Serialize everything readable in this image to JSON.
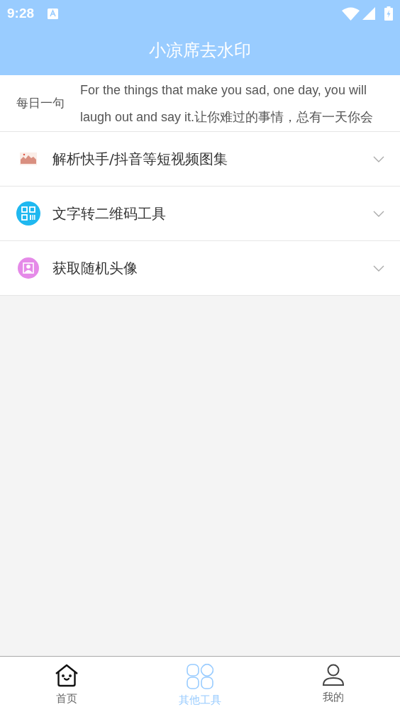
{
  "status_bar": {
    "time": "9:28"
  },
  "header": {
    "title": "小凉席去水印"
  },
  "daily_quote": {
    "label": "每日一句",
    "lines": [
      "For the things that make you sad, one day, you will",
      "laugh out and say it.让你难过的事情，总有一天你会"
    ]
  },
  "tools": [
    {
      "kind": "gallery",
      "label": "解析快手/抖音等短视频图集",
      "expanded": false
    },
    {
      "kind": "qrcode",
      "label": "文字转二维码工具",
      "expanded": false
    },
    {
      "kind": "avatar",
      "label": "获取随机头像",
      "expanded": false
    }
  ],
  "tabs": [
    {
      "kind": "home",
      "label": "首页",
      "selected": false
    },
    {
      "kind": "tools",
      "label": "其他工具",
      "selected": true
    },
    {
      "kind": "profile",
      "label": "我的",
      "selected": false
    }
  ]
}
